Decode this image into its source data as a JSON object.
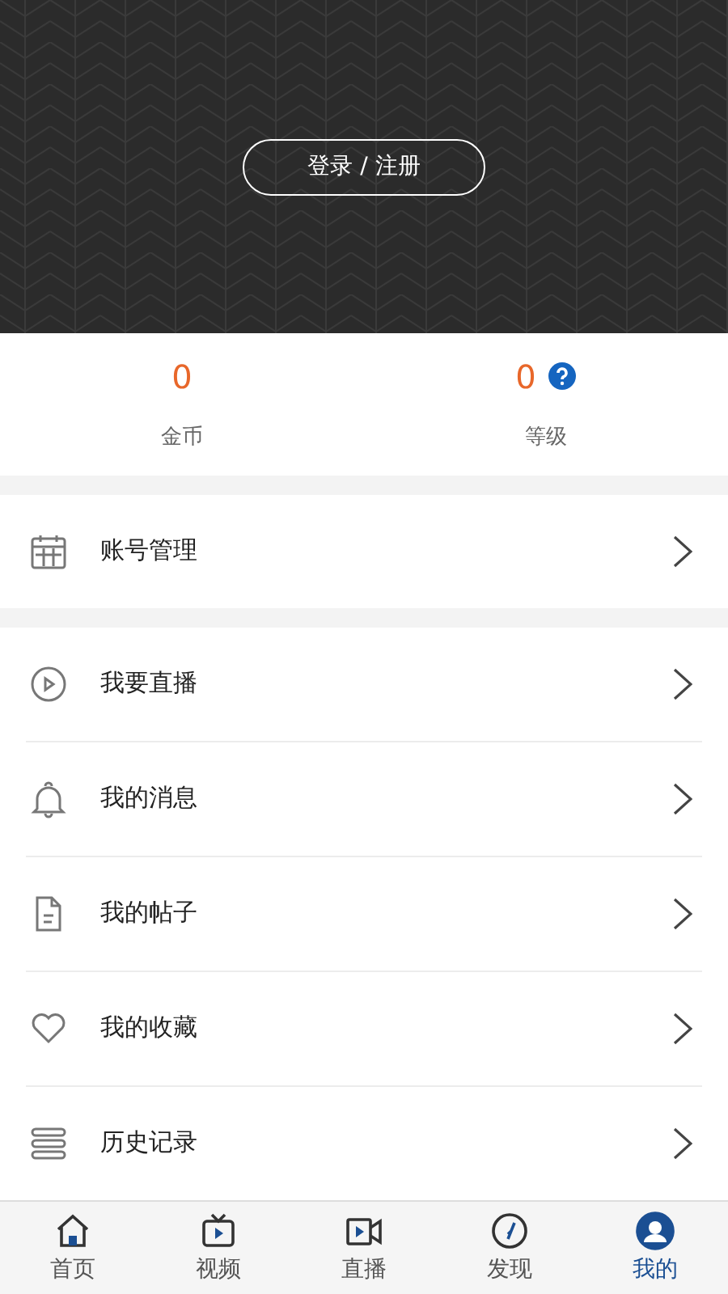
{
  "header": {
    "login_button": "登录 / 注册"
  },
  "stats": [
    {
      "value": "0",
      "label": "金币",
      "help": false
    },
    {
      "value": "0",
      "label": "等级",
      "help": true
    }
  ],
  "menu_sections": [
    {
      "items": [
        {
          "kind": "calendar",
          "label": "账号管理"
        }
      ]
    },
    {
      "items": [
        {
          "kind": "live",
          "label": "我要直播"
        },
        {
          "kind": "bell",
          "label": "我的消息"
        },
        {
          "kind": "document",
          "label": "我的帖子"
        },
        {
          "kind": "heart",
          "label": "我的收藏"
        },
        {
          "kind": "history",
          "label": "历史记录"
        }
      ]
    }
  ],
  "tab_bar": [
    {
      "kind": "home",
      "label": "首页",
      "selected": false
    },
    {
      "kind": "video",
      "label": "视频",
      "selected": false
    },
    {
      "kind": "live",
      "label": "直播",
      "selected": false
    },
    {
      "kind": "discover",
      "label": "发现",
      "selected": false
    },
    {
      "kind": "profile",
      "label": "我的",
      "selected": true
    }
  ]
}
